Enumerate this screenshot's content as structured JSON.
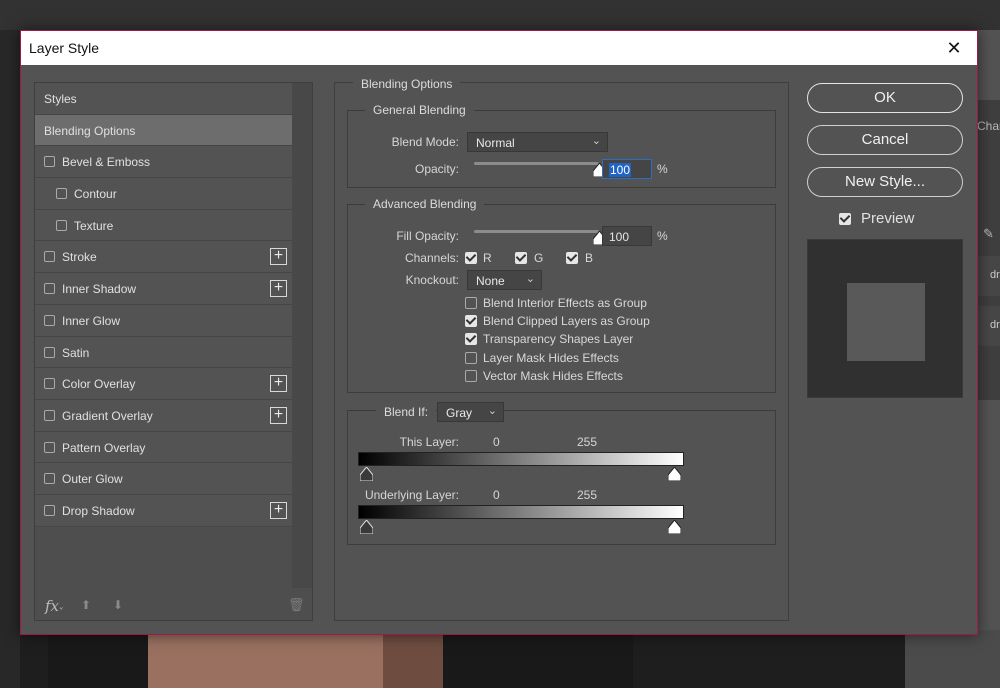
{
  "background_app": {
    "right_panel": {
      "tab": "Char",
      "layer_items": [
        "dr",
        "dr"
      ]
    }
  },
  "dialog": {
    "title": "Layer Style",
    "close_glyph": "✕"
  },
  "styles_panel": {
    "header": "Styles",
    "items": [
      {
        "label": "Blending Options",
        "selected": true,
        "checkbox": false,
        "plus": false
      },
      {
        "label": "Bevel & Emboss",
        "checkbox": true,
        "checked": false,
        "plus": false
      },
      {
        "label": "Contour",
        "checkbox": true,
        "checked": false,
        "plus": false,
        "sub": true
      },
      {
        "label": "Texture",
        "checkbox": true,
        "checked": false,
        "plus": false,
        "sub": true
      },
      {
        "label": "Stroke",
        "checkbox": true,
        "checked": false,
        "plus": true
      },
      {
        "label": "Inner Shadow",
        "checkbox": true,
        "checked": false,
        "plus": true
      },
      {
        "label": "Inner Glow",
        "checkbox": true,
        "checked": false,
        "plus": false
      },
      {
        "label": "Satin",
        "checkbox": true,
        "checked": false,
        "plus": false
      },
      {
        "label": "Color Overlay",
        "checkbox": true,
        "checked": false,
        "plus": true
      },
      {
        "label": "Gradient Overlay",
        "checkbox": true,
        "checked": false,
        "plus": true
      },
      {
        "label": "Pattern Overlay",
        "checkbox": true,
        "checked": false,
        "plus": false
      },
      {
        "label": "Outer Glow",
        "checkbox": true,
        "checked": false,
        "plus": false
      },
      {
        "label": "Drop Shadow",
        "checkbox": true,
        "checked": false,
        "plus": true
      }
    ],
    "plus_glyph": "+",
    "footer": {
      "fx": "fx",
      "fx_caret": "˅",
      "up_glyph": "⬆",
      "down_glyph": "⬇",
      "trash_glyph": "🗑"
    }
  },
  "blending_options": {
    "title": "Blending Options",
    "general": {
      "legend": "General Blending",
      "blend_mode_label": "Blend Mode:",
      "blend_mode": "Normal",
      "opacity_label": "Opacity:",
      "opacity": "100",
      "opacity_level": 1.0,
      "percent": "%"
    },
    "advanced": {
      "legend": "Advanced Blending",
      "fill_opacity_label": "Fill Opacity:",
      "fill_opacity": "100",
      "fill_opacity_level": 1.0,
      "percent": "%",
      "channels_label": "Channels:",
      "channels": [
        {
          "label": "R",
          "checked": true
        },
        {
          "label": "G",
          "checked": true
        },
        {
          "label": "B",
          "checked": true
        }
      ],
      "knockout_label": "Knockout:",
      "knockout": "None",
      "options": [
        {
          "label": "Blend Interior Effects as Group",
          "checked": false
        },
        {
          "label": "Blend Clipped Layers as Group",
          "checked": true
        },
        {
          "label": "Transparency Shapes Layer",
          "checked": true
        },
        {
          "label": "Layer Mask Hides Effects",
          "checked": false
        },
        {
          "label": "Vector Mask Hides Effects",
          "checked": false
        }
      ]
    },
    "blend_if": {
      "label": "Blend If:",
      "channel": "Gray",
      "this_layer_label": "This Layer:",
      "this_layer_min": "0",
      "this_layer_max": "255",
      "underlying_label": "Underlying Layer:",
      "underlying_min": "0",
      "underlying_max": "255"
    },
    "chevron_glyph": "⌄"
  },
  "buttons": {
    "ok": "OK",
    "cancel": "Cancel",
    "new_style": "New Style..."
  },
  "preview": {
    "label": "Preview",
    "checked": true
  }
}
